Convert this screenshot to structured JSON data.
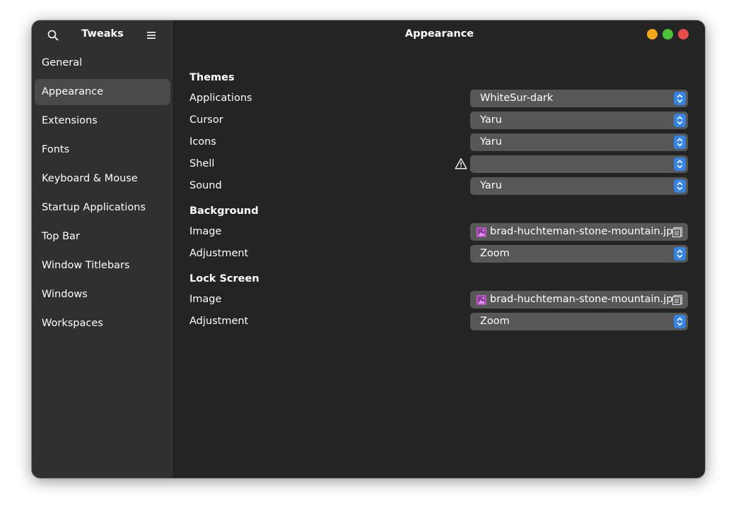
{
  "sidebar": {
    "title": "Tweaks",
    "search_icon": "search-icon",
    "menu_icon": "hamburger-menu-icon",
    "items": [
      {
        "label": "General",
        "selected": false
      },
      {
        "label": "Appearance",
        "selected": true
      },
      {
        "label": "Extensions",
        "selected": false
      },
      {
        "label": "Fonts",
        "selected": false
      },
      {
        "label": "Keyboard & Mouse",
        "selected": false
      },
      {
        "label": "Startup Applications",
        "selected": false
      },
      {
        "label": "Top Bar",
        "selected": false
      },
      {
        "label": "Window Titlebars",
        "selected": false
      },
      {
        "label": "Windows",
        "selected": false
      },
      {
        "label": "Workspaces",
        "selected": false
      }
    ]
  },
  "header": {
    "title": "Appearance",
    "window_controls": {
      "minimize_color": "#f6a818",
      "maximize_color": "#4cc238",
      "close_color": "#e84c4c"
    }
  },
  "themes": {
    "title": "Themes",
    "applications": {
      "label": "Applications",
      "value": "WhiteSur-dark"
    },
    "cursor": {
      "label": "Cursor",
      "value": "Yaru"
    },
    "icons": {
      "label": "Icons",
      "value": "Yaru"
    },
    "shell": {
      "label": "Shell",
      "value": "",
      "warning_icon": "warning-icon"
    },
    "sound": {
      "label": "Sound",
      "value": "Yaru"
    }
  },
  "background": {
    "title": "Background",
    "image": {
      "label": "Image",
      "value": "brad-huchteman-stone-mountain.jpg"
    },
    "adjustment": {
      "label": "Adjustment",
      "value": "Zoom"
    }
  },
  "lock_screen": {
    "title": "Lock Screen",
    "image": {
      "label": "Image",
      "value": "brad-huchteman-stone-mountain.jpg"
    },
    "adjustment": {
      "label": "Adjustment",
      "value": "Zoom"
    }
  },
  "colors": {
    "accent": "#3584e4",
    "window_bg": "#242424",
    "sidebar_bg": "#303030",
    "image_file_icon": "#c061cb"
  }
}
